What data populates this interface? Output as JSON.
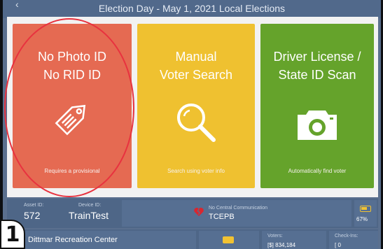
{
  "header": {
    "title": "Election Day - May 1, 2021 Local Elections",
    "back_glyph": "‹"
  },
  "tiles": [
    {
      "label_line1": "No Photo ID",
      "label_line2": "No RID ID",
      "subtitle": "Requires a provisional",
      "icon": "tag-icon",
      "color": "#e56a52"
    },
    {
      "label_line1": "Manual",
      "label_line2": "Voter Search",
      "subtitle": "Search using voter info",
      "icon": "magnifier-icon",
      "color": "#efc130"
    },
    {
      "label_line1": "Driver License /",
      "label_line2": "State ID Scan",
      "subtitle": "Automatically find voter",
      "icon": "camera-icon",
      "color": "#65a32b"
    }
  ],
  "status": {
    "asset_label": "Asset ID:",
    "asset_value": "572",
    "device_label": "Device ID:",
    "device_value": "TrainTest",
    "comm_label": "No Central Communication",
    "comm_value": "TCEPB",
    "battery_pct": "67%"
  },
  "footer": {
    "location": "Dittmar Recreation Center",
    "voters_label": "Voters:",
    "voters_value": "[$] 834,184",
    "checkins_label": "Check-Ins:",
    "checkins_value": "[ 0"
  },
  "step_badge": "1",
  "colors": {
    "highlight": "#e8323f",
    "accent": "#f1c232"
  }
}
